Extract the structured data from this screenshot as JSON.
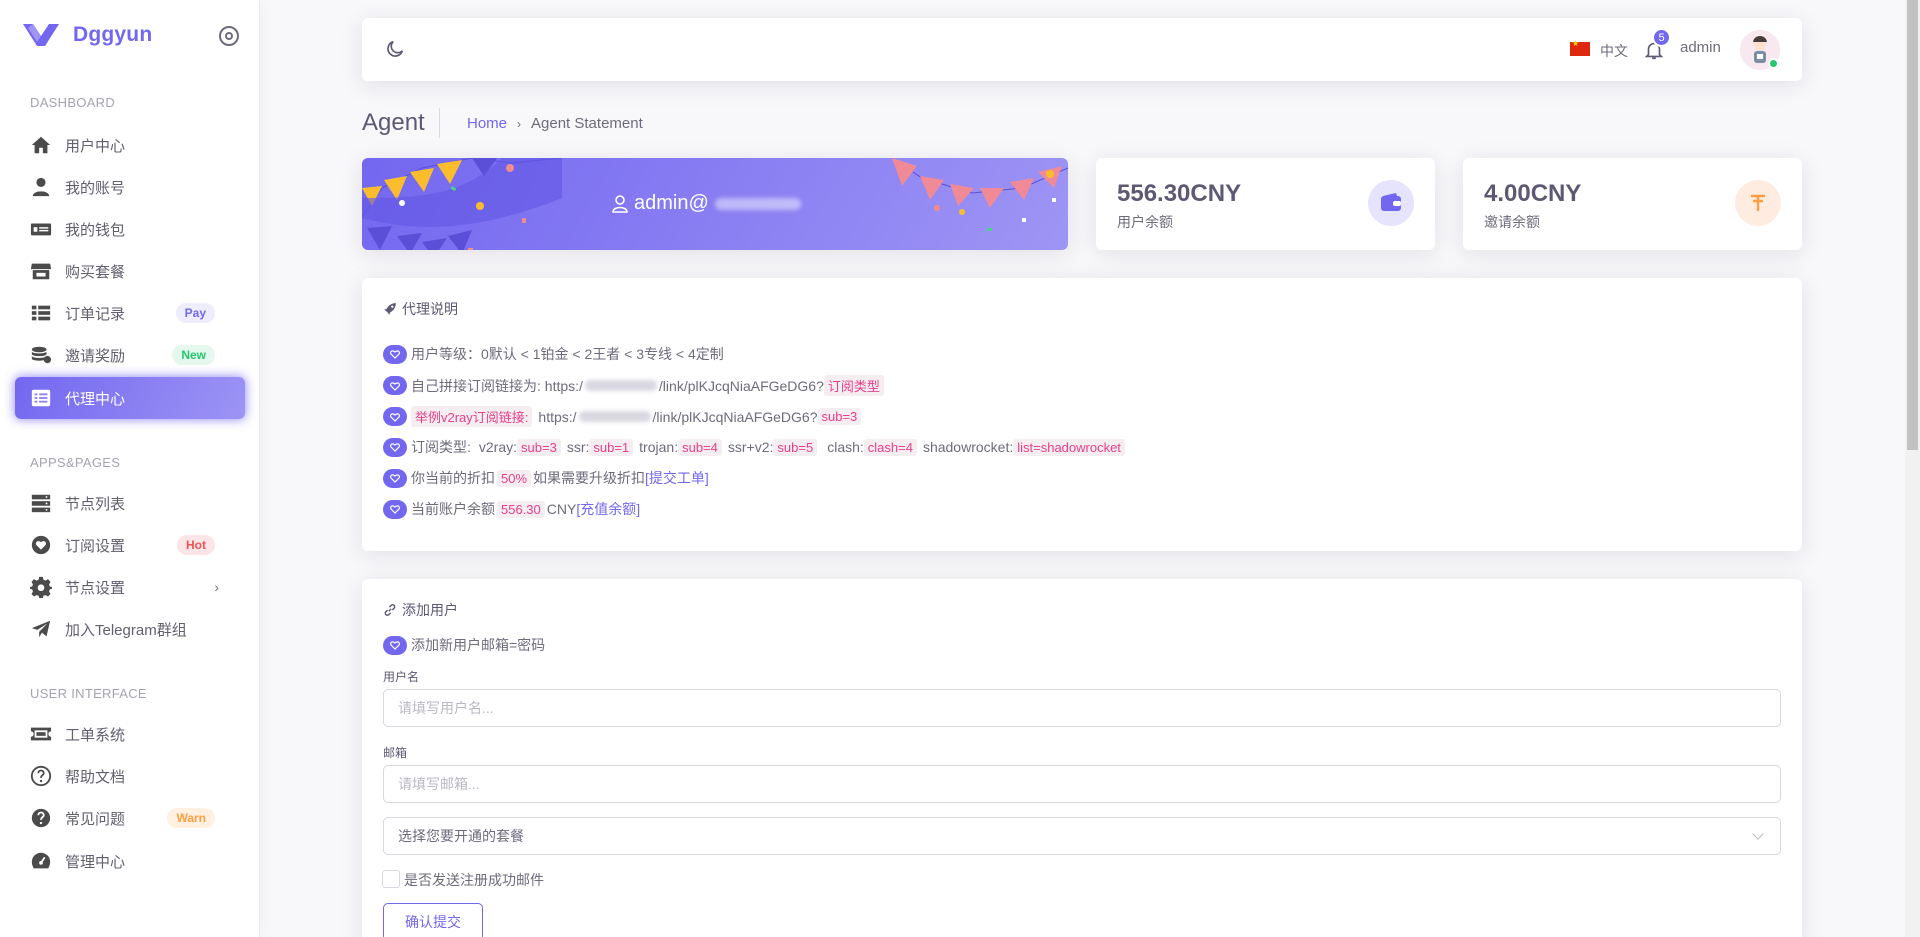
{
  "brand": {
    "name": "Dggyun"
  },
  "sidebar": {
    "sections": [
      "DASHBOARD",
      "APPS&PAGES",
      "USER INTERFACE"
    ],
    "items": [
      {
        "label": "用户中心",
        "icon": "home-icon"
      },
      {
        "label": "我的账号",
        "icon": "user-icon"
      },
      {
        "label": "我的钱包",
        "icon": "money-bill-icon"
      },
      {
        "label": "购买套餐",
        "icon": "store-icon"
      },
      {
        "label": "订单记录",
        "icon": "list-icon",
        "badge": "Pay"
      },
      {
        "label": "邀请奖励",
        "icon": "coins-icon",
        "badge": "New"
      },
      {
        "label": "代理中心",
        "icon": "agent-list-icon",
        "active": true
      },
      {
        "label": "节点列表",
        "icon": "server-icon"
      },
      {
        "label": "订阅设置",
        "icon": "heart-icon",
        "badge": "Hot"
      },
      {
        "label": "节点设置",
        "icon": "gear-icon"
      },
      {
        "label": "加入Telegram群组",
        "icon": "paper-plane-icon"
      },
      {
        "label": "工单系统",
        "icon": "ticket-icon"
      },
      {
        "label": "帮助文档",
        "icon": "question-circle-icon"
      },
      {
        "label": "常见问题",
        "icon": "question-icon",
        "badge": "Warn"
      },
      {
        "label": "管理中心",
        "icon": "dashboard-icon"
      }
    ]
  },
  "navbar": {
    "language": "中文",
    "notifications": "5",
    "user": "admin",
    "colors": {
      "accent": "#7367f0",
      "online": "#28c76f"
    }
  },
  "breadcrumb": {
    "title": "Agent",
    "home": "Home",
    "current": "Agent Statement"
  },
  "banner": {
    "user": "admin@"
  },
  "stats": [
    {
      "value": "556.30CNY",
      "label": "用户余额",
      "icon": "wallet-icon"
    },
    {
      "value": "4.00CNY",
      "label": "邀请余额",
      "icon": "tether-icon"
    }
  ],
  "agent_info": {
    "title": "代理说明",
    "level_line": "用户等级：0默认 < 1铂金 < 2王者 < 3专线 < 4定制",
    "link_line_prefix": "自己拼接订阅链接为: https:/",
    "link_line_suffix": "/link/plKJcqNiaAFGeDG6?",
    "link_line_tag": "订阅类型",
    "example_tag": "举例v2ray订阅链接:",
    "example_prefix": "https:/",
    "example_suffix": "/link/plKJcqNiaAFGeDG6?",
    "example_param": "sub=3",
    "types_label": "订阅类型:",
    "types": [
      {
        "name": "v2ray:",
        "param": "sub=3"
      },
      {
        "name": "ssr:",
        "param": "sub=1"
      },
      {
        "name": "trojan:",
        "param": "sub=4"
      },
      {
        "name": "ssr+v2:",
        "param": "sub=5"
      },
      {
        "name": "clash:",
        "param": "clash=4"
      },
      {
        "name": "shadowrocket:",
        "param": "list=shadowrocket"
      }
    ],
    "discount_prefix": "你当前的折扣",
    "discount_value": "50%",
    "discount_suffix": "如果需要升级折扣",
    "discount_link": "[提交工单]",
    "balance_prefix": "当前账户余额",
    "balance_value": "556.30",
    "balance_unit": "CNY",
    "balance_link": "[充值余额]"
  },
  "add_user": {
    "title": "添加用户",
    "note": "添加新用户邮箱=密码",
    "username_label": "用户名",
    "username_placeholder": "请填写用户名...",
    "email_label": "邮箱",
    "email_placeholder": "请填写邮箱...",
    "plan_select": "选择您要开通的套餐",
    "send_email_label": "是否发送注册成功邮件",
    "submit_label": "确认提交"
  }
}
